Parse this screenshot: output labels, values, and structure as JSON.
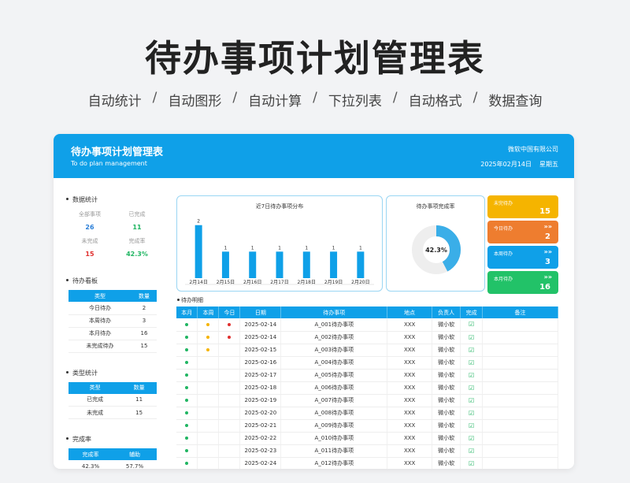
{
  "hero": {
    "title": "待办事项计划管理表",
    "features": [
      "自动统计",
      "自动图形",
      "自动计算",
      "下拉列表",
      "自动格式",
      "数据查询"
    ],
    "separator": "/"
  },
  "header": {
    "title": "待办事项计划管理表",
    "subtitle": "To do plan management",
    "company": "微软中国有限公司",
    "date": "2025年02月14日",
    "weekday": "星期五"
  },
  "stats": {
    "title": "数据统计",
    "items": [
      {
        "label": "全部事项",
        "value": "26",
        "color": "#2b7fd8"
      },
      {
        "label": "已完成",
        "value": "11",
        "color": "#20b562"
      },
      {
        "label": "未完成",
        "value": "15",
        "color": "#e0302f"
      },
      {
        "label": "完成率",
        "value": "42.3%",
        "color": "#20b562"
      }
    ]
  },
  "board": {
    "title": "待办看板",
    "headers": [
      "类型",
      "数量"
    ],
    "rows": [
      [
        "今日待办",
        "2"
      ],
      [
        "本周待办",
        "3"
      ],
      [
        "本月待办",
        "16"
      ],
      [
        "未完成待办",
        "15"
      ]
    ]
  },
  "type_stats": {
    "title": "类型统计",
    "headers": [
      "类型",
      "数量"
    ],
    "rows": [
      [
        "已完成",
        "11"
      ],
      [
        "未完成",
        "15"
      ]
    ]
  },
  "rate": {
    "title": "完成率",
    "headers": [
      "完成率",
      "辅助"
    ],
    "rows": [
      [
        "42.3%",
        "57.7%"
      ]
    ]
  },
  "chart_data": {
    "type": "bar",
    "title": "近7日待办事项分布",
    "categories": [
      "2月14日",
      "2月15日",
      "2月16日",
      "2月17日",
      "2月18日",
      "2月19日",
      "2月20日"
    ],
    "values": [
      2,
      1,
      1,
      1,
      1,
      1,
      1
    ],
    "ylim": [
      0,
      2.2
    ],
    "color": "#0fa0e8"
  },
  "donut": {
    "title": "待办事项完成率",
    "value": 0.423,
    "label": "42.3%",
    "color": "#3aaee8",
    "track": "#eeeeee"
  },
  "kpis": [
    {
      "label": "未完待办",
      "value": "15",
      "color": "#f5b400",
      "icon": ""
    },
    {
      "label": "今日待办",
      "value": "2",
      "color": "#ee7d2f",
      "icon": "»»"
    },
    {
      "label": "本周待办",
      "value": "3",
      "color": "#0fa0e8",
      "icon": "»»"
    },
    {
      "label": "本月待办",
      "value": "16",
      "color": "#22c268",
      "icon": "»»"
    }
  ],
  "detail": {
    "title": "待办明细",
    "headers": [
      "本月",
      "本周",
      "今日",
      "日期",
      "待办事项",
      "地点",
      "负责人",
      "完成",
      "备注"
    ],
    "rows": [
      {
        "m": "green",
        "w": "yellow",
        "d": "red",
        "date": "2025-02-14",
        "task": "A_001待办事项",
        "place": "XXX",
        "owner": "微小软"
      },
      {
        "m": "green",
        "w": "yellow",
        "d": "red",
        "date": "2025-02-14",
        "task": "A_002待办事项",
        "place": "XXX",
        "owner": "微小软"
      },
      {
        "m": "green",
        "w": "yellow",
        "d": "",
        "date": "2025-02-15",
        "task": "A_003待办事项",
        "place": "XXX",
        "owner": "微小软"
      },
      {
        "m": "green",
        "w": "",
        "d": "",
        "date": "2025-02-16",
        "task": "A_004待办事项",
        "place": "XXX",
        "owner": "微小软"
      },
      {
        "m": "green",
        "w": "",
        "d": "",
        "date": "2025-02-17",
        "task": "A_005待办事项",
        "place": "XXX",
        "owner": "微小软"
      },
      {
        "m": "green",
        "w": "",
        "d": "",
        "date": "2025-02-18",
        "task": "A_006待办事项",
        "place": "XXX",
        "owner": "微小软"
      },
      {
        "m": "green",
        "w": "",
        "d": "",
        "date": "2025-02-19",
        "task": "A_007待办事项",
        "place": "XXX",
        "owner": "微小软"
      },
      {
        "m": "green",
        "w": "",
        "d": "",
        "date": "2025-02-20",
        "task": "A_008待办事项",
        "place": "XXX",
        "owner": "微小软"
      },
      {
        "m": "green",
        "w": "",
        "d": "",
        "date": "2025-02-21",
        "task": "A_009待办事项",
        "place": "XXX",
        "owner": "微小软"
      },
      {
        "m": "green",
        "w": "",
        "d": "",
        "date": "2025-02-22",
        "task": "A_010待办事项",
        "place": "XXX",
        "owner": "微小软"
      },
      {
        "m": "green",
        "w": "",
        "d": "",
        "date": "2025-02-23",
        "task": "A_011待办事项",
        "place": "XXX",
        "owner": "微小软"
      },
      {
        "m": "green",
        "w": "",
        "d": "",
        "date": "2025-02-24",
        "task": "A_012待办事项",
        "place": "XXX",
        "owner": "微小软"
      }
    ],
    "check_symbol": "☑",
    "dot_colors": {
      "green": "#20b562",
      "yellow": "#f5b400",
      "red": "#e0302f"
    }
  }
}
